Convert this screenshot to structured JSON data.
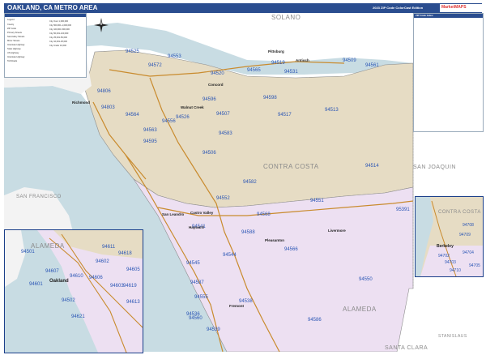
{
  "header": {
    "title": "OAKLAND, CA METRO AREA",
    "edition": "2023 ZIP Code ColorCast Edition",
    "logo_text": "MarketMAPS"
  },
  "counties": [
    {
      "name": "SOLANO"
    },
    {
      "name": "CONTRA COSTA"
    },
    {
      "name": "SAN JOAQUIN"
    },
    {
      "name": "SAN FRANCISCO"
    },
    {
      "name": "ALAMEDA"
    },
    {
      "name": "SANTA CLARA"
    },
    {
      "name": "STANISLAUS"
    }
  ],
  "cities": [
    "Concord",
    "Walnut Creek",
    "Richmond",
    "Hayward",
    "Fremont",
    "Oakland",
    "Berkeley",
    "Pittsburg",
    "Antioch",
    "Livermore",
    "Pleasanton",
    "Castro Valley",
    "San Leandro"
  ],
  "zips_main": [
    "94525",
    "94572",
    "94553",
    "94519",
    "94565",
    "94509",
    "94531",
    "94561",
    "94520",
    "94806",
    "94803",
    "94564",
    "94596",
    "94507",
    "94598",
    "94517",
    "94513",
    "94583",
    "94506",
    "94526",
    "94563",
    "94556",
    "94595",
    "94514",
    "94582",
    "94552",
    "94551",
    "94568",
    "94588",
    "94566",
    "94541",
    "94545",
    "94544",
    "94587",
    "94555",
    "94538",
    "94536",
    "94539",
    "94560",
    "94550",
    "94586",
    "95391"
  ],
  "zips_inset_left": [
    "94501",
    "94502",
    "94607",
    "94610",
    "94602",
    "94606",
    "94601",
    "94621",
    "94603",
    "94605",
    "94611",
    "94618",
    "94619",
    "94613"
  ],
  "zips_inset_right": [
    "94708",
    "94709",
    "94702",
    "94703",
    "94704",
    "94705",
    "94710"
  ],
  "inset_left_labels": {
    "county": "ALAMEDA",
    "city": "Oakland"
  },
  "inset_right_labels": {
    "county": "CONTRA COSTA",
    "city": "Berkeley"
  },
  "legend": {
    "title": "Legend",
    "items": [
      "County",
      "ZIP Code",
      "Primary Streets",
      "Secondary Streets",
      "Minor Streets",
      "Interstate Highway",
      "State Highway",
      "US Highway",
      "Interstate Highway",
      "Toll Roads"
    ],
    "city_labels": [
      "City Over 1,000,000",
      "City 500,001-1,000,000",
      "City 100,001-500,000",
      "City 50,001-100,000",
      "City 25,001-50,000",
      "City 10,001-25,000",
      "City Under 10,000"
    ]
  },
  "index": {
    "title": "ZIP Code Index"
  },
  "colors": {
    "contra_costa": "#e6dcc4",
    "alameda": "#ede0f2",
    "water": "#c8dce3",
    "surroundings": "#ffffff",
    "zip_text": "#2b56b5",
    "header_bar": "#2a4d8f"
  }
}
